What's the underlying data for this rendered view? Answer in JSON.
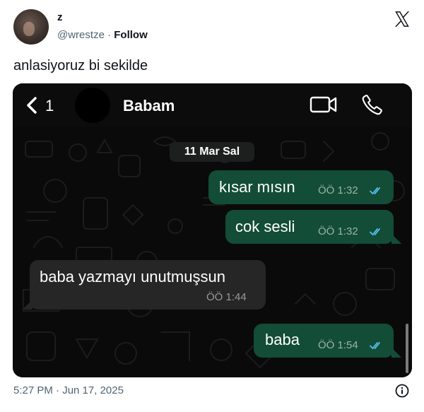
{
  "tweet": {
    "author_name": "z",
    "handle": "@wrestze",
    "separator": "·",
    "follow_label": "Follow",
    "text": "anlasiyoruz bi sekilde",
    "timestamp": "5:27 PM · Jun 17, 2025"
  },
  "chat_screenshot": {
    "back_count": "1",
    "contact_name": "Babam",
    "date_chip": "11 Mar Sal",
    "messages": [
      {
        "direction": "outgoing",
        "text": "kısar mısın",
        "time": "ÖÖ 1:32",
        "read": true
      },
      {
        "direction": "outgoing",
        "text": "cok sesli",
        "time": "ÖÖ 1:32",
        "read": true
      },
      {
        "direction": "incoming",
        "text": "baba yazmayı unutmuşsun",
        "time": "ÖÖ 1:44"
      },
      {
        "direction": "outgoing",
        "text": "baba",
        "time": "ÖÖ 1:54",
        "read": true
      }
    ],
    "colors": {
      "outgoing_bubble": "#134d37",
      "incoming_bubble": "#262626",
      "read_ticks": "#53bdeb",
      "background": "#0a0a0a"
    }
  },
  "icons": [
    "x-logo-icon",
    "chevron-left-icon",
    "video-camera-icon",
    "phone-icon",
    "info-icon"
  ]
}
